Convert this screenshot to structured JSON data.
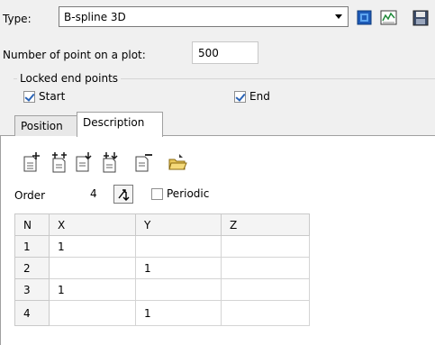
{
  "type": {
    "label": "Type:",
    "value": "B-spline 3D"
  },
  "toolbar": {
    "icons": [
      "view-3d-icon",
      "plot-icon",
      "save-icon"
    ]
  },
  "points": {
    "label": "Number of point on a plot:",
    "value": "500"
  },
  "locked": {
    "title": "Locked end points",
    "start_label": "Start",
    "start_checked": true,
    "end_label": "End",
    "end_checked": true
  },
  "tabs": [
    {
      "label": "Position",
      "active": false
    },
    {
      "label": "Description",
      "active": true
    }
  ],
  "actions": {
    "icons": [
      "add-point-icon",
      "insert-points-icon",
      "insert-point-below-icon",
      "insert-points-below-icon",
      "remove-point-icon",
      "open-folder-icon"
    ]
  },
  "order": {
    "label": "Order",
    "value": "4",
    "periodic_label": "Periodic",
    "periodic_checked": false
  },
  "table": {
    "columns": [
      "N",
      "X",
      "Y",
      "Z"
    ],
    "rows": [
      {
        "n": "1",
        "x": "1",
        "y": "",
        "z": ""
      },
      {
        "n": "2",
        "x": "",
        "y": "1",
        "z": ""
      },
      {
        "n": "3",
        "x": "1",
        "y": "",
        "z": ""
      },
      {
        "n": "4",
        "x": "",
        "y": "1",
        "z": ""
      }
    ]
  },
  "colors": {
    "accent": "#2a63b6",
    "border": "#a0a0a0",
    "background": "#f0f0f0"
  }
}
